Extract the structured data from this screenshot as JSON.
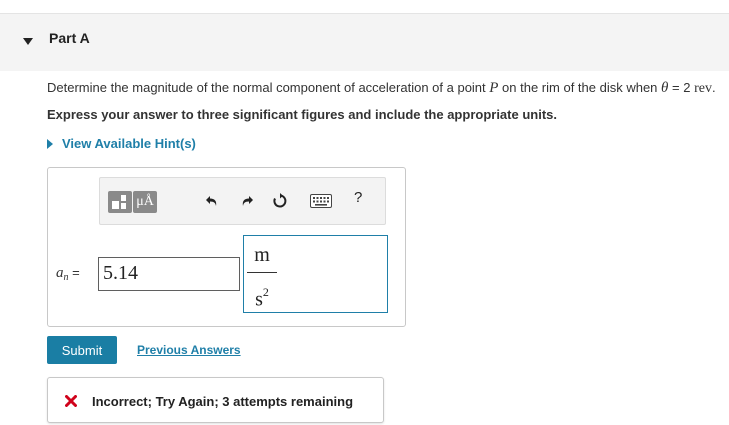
{
  "part": {
    "title": "Part A"
  },
  "question": {
    "prefix": "Determine the magnitude of the normal component of acceleration of a point ",
    "point_var": "P",
    "middle": " on the rim of the disk when ",
    "theta": "θ",
    "equals": " = 2 ",
    "unit": "rev",
    "suffix": "."
  },
  "instructions": "Express your answer to three significant figures and include the appropriate units.",
  "hint_link": "View Available Hint(s)",
  "toolbar": {
    "units_label": "μÅ",
    "help_label": "?",
    "icons": [
      "templates-icon",
      "units-icon",
      "undo-icon",
      "redo-icon",
      "reset-icon",
      "keyboard-icon",
      "help-icon"
    ]
  },
  "answer": {
    "var_symbol": "a",
    "var_sub": "n",
    "equals": " = ",
    "value": "5.14",
    "unit_numerator": "m",
    "unit_denominator": "s",
    "unit_exponent": "2"
  },
  "actions": {
    "submit_label": "Submit",
    "previous_answers": "Previous Answers"
  },
  "feedback": {
    "text": "Incorrect; Try Again; 3 attempts remaining",
    "status_color": "#d0021b"
  },
  "colors": {
    "link": "#1f7fa8",
    "submit_bg": "#1a7ea4",
    "header_bg": "#f4f4f4"
  }
}
